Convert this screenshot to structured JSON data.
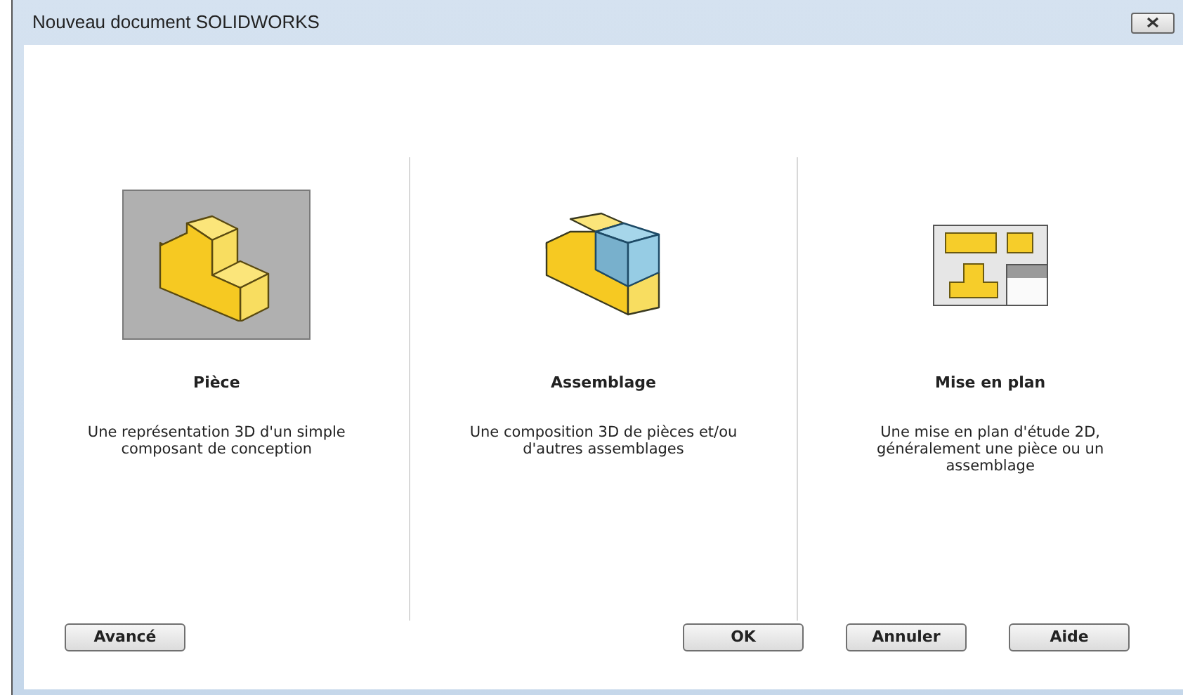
{
  "window": {
    "title": "Nouveau document SOLIDWORKS"
  },
  "document_types": [
    {
      "kind": "part",
      "label": "Pièce",
      "description": "Une représentation 3D d'un simple composant de conception",
      "selected": true
    },
    {
      "kind": "assembly",
      "label": "Assemblage",
      "description": "Une composition 3D de pièces et/ou d'autres assemblages",
      "selected": false
    },
    {
      "kind": "drawing",
      "label": "Mise en plan",
      "description": "Une mise en plan d'étude 2D, généralement une pièce ou un assemblage",
      "selected": false
    }
  ],
  "buttons_left": [
    "Avancé"
  ],
  "buttons_right": [
    "OK",
    "Annuler",
    "Aide"
  ]
}
